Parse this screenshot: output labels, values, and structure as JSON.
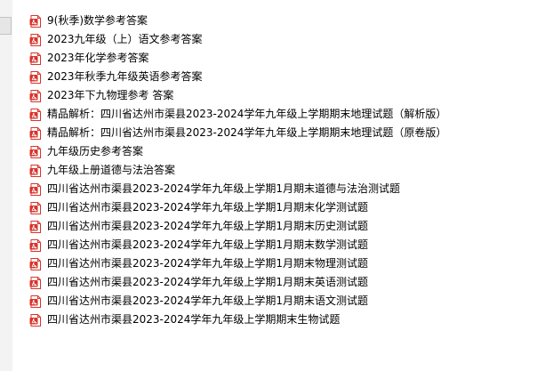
{
  "file_list": {
    "icon": "pdf-file-icon",
    "icon_color": "#d9342b",
    "items": [
      {
        "name": "9(秋季)数学参考答案"
      },
      {
        "name": "2023九年级（上）语文参考答案"
      },
      {
        "name": "2023年化学参考答案"
      },
      {
        "name": "2023年秋季九年级英语参考答案"
      },
      {
        "name": "2023年下九物理参考 答案"
      },
      {
        "name": "精品解析：四川省达州市渠县2023-2024学年九年级上学期期末地理试题（解析版）"
      },
      {
        "name": "精品解析：四川省达州市渠县2023-2024学年九年级上学期期末地理试题（原卷版）"
      },
      {
        "name": "九年级历史参考答案"
      },
      {
        "name": "九年级上册道德与法治答案"
      },
      {
        "name": "四川省达州市渠县2023-2024学年九年级上学期1月期末道德与法治测试题"
      },
      {
        "name": "四川省达州市渠县2023-2024学年九年级上学期1月期末化学测试题"
      },
      {
        "name": "四川省达州市渠县2023-2024学年九年级上学期1月期末历史测试题"
      },
      {
        "name": "四川省达州市渠县2023-2024学年九年级上学期1月期末数学测试题"
      },
      {
        "name": "四川省达州市渠县2023-2024学年九年级上学期1月期末物理测试题"
      },
      {
        "name": "四川省达州市渠县2023-2024学年九年级上学期1月期末英语测试题"
      },
      {
        "name": "四川省达州市渠县2023-2024学年九年级上学期1月期末语文测试题"
      },
      {
        "name": "四川省达州市渠县2023-2024学年九年级上学期期末生物试题"
      }
    ]
  }
}
